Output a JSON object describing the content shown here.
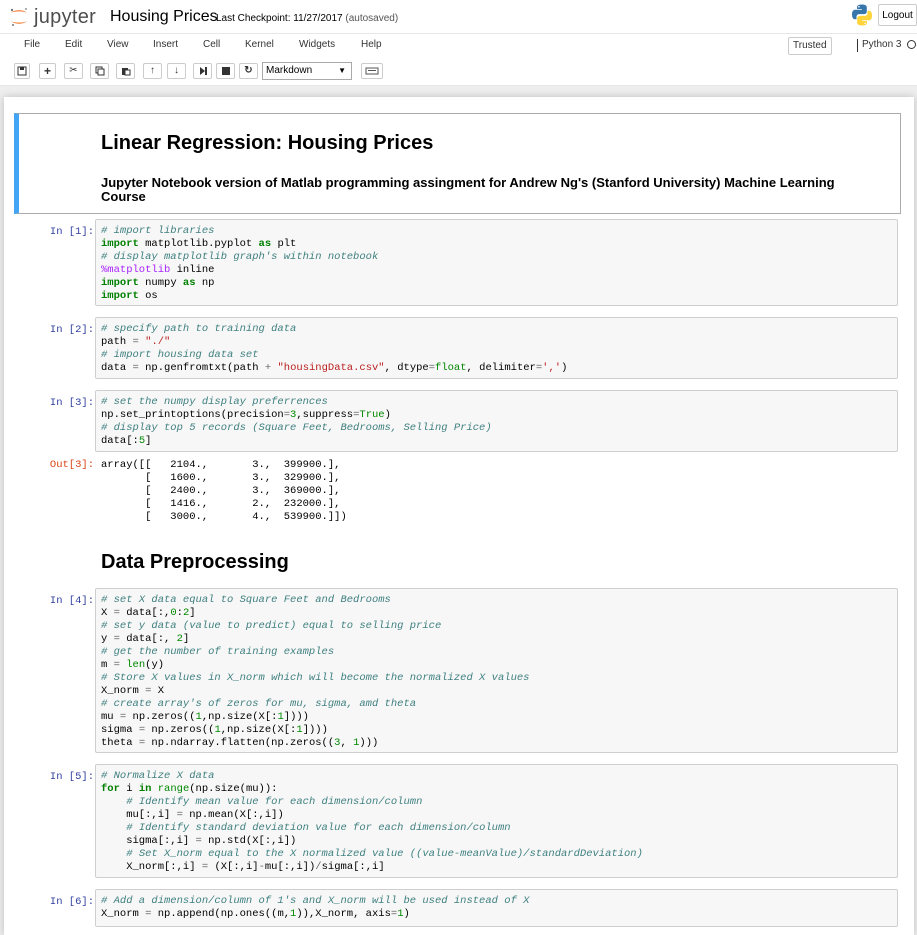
{
  "header": {
    "logo_text": "jupyter",
    "notebook_title": "Housing Prices",
    "checkpoint_label": "Last Checkpoint: 11/27/2017",
    "checkpoint_status": "(autosaved)",
    "logout_label": "Logout"
  },
  "menubar": {
    "items": [
      "File",
      "Edit",
      "View",
      "Insert",
      "Cell",
      "Kernel",
      "Widgets",
      "Help"
    ],
    "trusted_label": "Trusted",
    "kernel_name": "Python 3"
  },
  "toolbar": {
    "cell_type": "Markdown"
  },
  "cells": {
    "md1_h1": "Linear Regression: Housing Prices",
    "md1_h3": "Jupyter Notebook version of Matlab programming assingment for Andrew Ng's (Stanford University) Machine Learning Course",
    "md2_h1": "Data Preprocessing",
    "in1_prompt": "In [1]:",
    "in2_prompt": "In [2]:",
    "in3_prompt": "In [3]:",
    "out3_prompt": "Out[3]:",
    "in4_prompt": "In [4]:",
    "in5_prompt": "In [5]:",
    "in6_prompt": "In [6]:",
    "out3_text": "array([[   2104.,       3.,  399900.],\n       [   1600.,       3.,  329900.],\n       [   2400.,       3.,  369000.],\n       [   1416.,       2.,  232000.],\n       [   3000.,       4.,  539900.]])"
  },
  "code": {
    "in1": [
      "# import libraries",
      "import matplotlib.pyplot as plt",
      "# display matplotlib graph's within notebook",
      "%matplotlib inline",
      "import numpy as np",
      "import os"
    ],
    "in2": [
      "# specify path to training data",
      "path = \"./\"",
      "# import housing data set",
      "data = np.genfromtxt(path + \"housingData.csv\", dtype=float, delimiter=',')"
    ],
    "in3": [
      "# set the numpy display preferrences",
      "np.set_printoptions(precision=3,suppress=True)",
      "# display top 5 records (Square Feet, Bedrooms, Selling Price)",
      "data[:5]"
    ],
    "in4": [
      "# set X data equal to Square Feet and Bedrooms",
      "X = data[:,0:2]",
      "# set y data (value to predict) equal to selling price",
      "y = data[:, 2]",
      "# get the number of training examples",
      "m = len(y)",
      "# Store X values in X_norm which will become the normalized X values",
      "X_norm = X",
      "# create array's of zeros for mu, sigma, amd theta",
      "mu = np.zeros((1,np.size(X[:1])))",
      "sigma = np.zeros((1,np.size(X[:1])))",
      "theta = np.ndarray.flatten(np.zeros((3, 1)))"
    ],
    "in5": [
      "# Normalize X data",
      "for i in range(np.size(mu)):",
      "    # Identify mean value for each dimension/column",
      "    mu[:,i] = np.mean(X[:,i])",
      "    # Identify standard deviation value for each dimension/column",
      "    sigma[:,i] = np.std(X[:,i])",
      "    # Set X_norm equal to the X normalized value ((value-meanValue)/standardDeviation)",
      "    X_norm[:,i] = (X[:,i]-mu[:,i])/sigma[:,i]"
    ],
    "in6": [
      "# Add a dimension/column of 1's and X_norm will be used instead of X",
      "X_norm = np.append(np.ones((m,1)),X_norm, axis=1)"
    ]
  }
}
